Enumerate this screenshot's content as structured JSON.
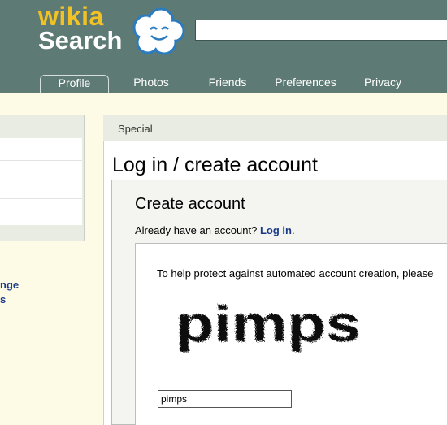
{
  "brand": {
    "logo_top": "wikia",
    "logo_bottom": "Search"
  },
  "search": {
    "value": ""
  },
  "tabs": [
    {
      "label": "Profile",
      "active": true
    },
    {
      "label": "Photos",
      "active": false
    },
    {
      "label": "Friends",
      "active": false
    },
    {
      "label": "Preferences",
      "active": false
    },
    {
      "label": "Privacy",
      "active": false
    }
  ],
  "sidebar": {
    "link_1": "nge",
    "link_2": "s"
  },
  "breadcrumb": "Special",
  "page_title": "Log in / create account",
  "form": {
    "title": "Create account",
    "already_text": "Already have an account?",
    "login_link": "Log in",
    "login_suffix": ".",
    "help_text": "To help protect against automated account creation, please",
    "captcha_word": "pimps",
    "captcha_input_value": "pimps"
  },
  "colors": {
    "header_bg": "#5e7a74",
    "logo_yellow": "#f2c224",
    "link_blue": "#1a3a8a",
    "page_bg": "#fdfbe6"
  }
}
